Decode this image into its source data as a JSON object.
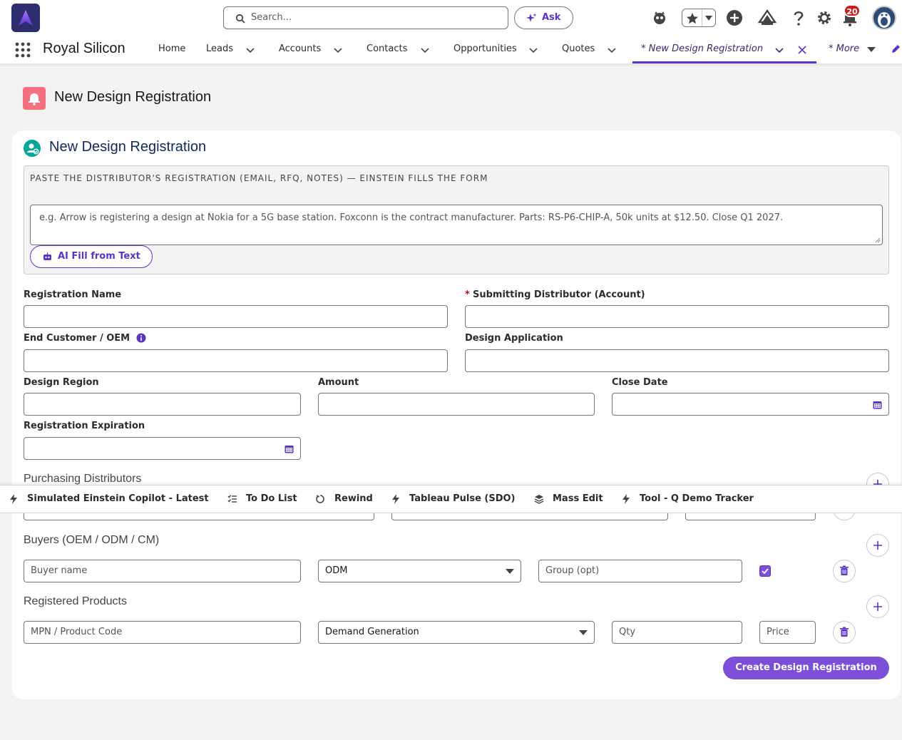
{
  "header": {
    "search_placeholder": "Search...",
    "ask_label": "Ask",
    "notification_count": "20"
  },
  "nav": {
    "app_name": "Royal Silicon",
    "items": [
      {
        "label": "Home"
      },
      {
        "label": "Leads"
      },
      {
        "label": "Accounts"
      },
      {
        "label": "Contacts"
      },
      {
        "label": "Opportunities"
      },
      {
        "label": "Quotes"
      }
    ],
    "active_tab": "* New Design Registration",
    "more": "* More"
  },
  "page": {
    "title": "New Design Registration"
  },
  "form": {
    "title": "New Design Registration",
    "ai_hint": "PASTE THE DISTRIBUTOR'S REGISTRATION (EMAIL, RFQ, NOTES) — EINSTEIN FILLS THE FORM",
    "ai_placeholder": "e.g. Arrow is registering a design at Nokia for a 5G base station. Foxconn is the contract manufacturer. Parts: RS-P6-CHIP-A, 50k units at $12.50. Close Q1 2027.",
    "ai_button": "AI Fill from Text",
    "fields": {
      "registration_name": "Registration Name",
      "required_mark": "*",
      "submitting_distributor": "Submitting Distributor (Account)",
      "end_customer": "End Customer / OEM",
      "design_application": "Design Application",
      "design_region": "Design Region",
      "amount": "Amount",
      "close_date": "Close Date",
      "registration_expiration": "Registration Expiration"
    },
    "purchasing_distributors": "Purchasing Distributors",
    "buyers": {
      "title": "Buyers (OEM / ODM / CM)",
      "buyer_placeholder": "Buyer name",
      "type_value": "ODM",
      "group_placeholder": "Group (opt)",
      "checked": true
    },
    "products": {
      "title": "Registered Products",
      "mpn_placeholder": "MPN / Product Code",
      "stage_value": "Demand Generation",
      "qty_placeholder": "Qty",
      "price_placeholder": "Price"
    },
    "submit_label": "Create Design Registration"
  },
  "utility_bar": {
    "items": [
      {
        "label": "Simulated Einstein Copilot - Latest",
        "icon": "bolt-icon"
      },
      {
        "label": "To Do List",
        "icon": "checklist-icon"
      },
      {
        "label": "Rewind",
        "icon": "rewind-icon"
      },
      {
        "label": "Tableau Pulse (SDO)",
        "icon": "bolt-icon"
      },
      {
        "label": "Mass Edit",
        "icon": "stack-icon"
      },
      {
        "label": "Tool - Q Demo Tracker",
        "icon": "bolt-icon"
      }
    ]
  },
  "colors": {
    "brand": "#5a33c9",
    "primary_button": "#7b4fd8",
    "page_icon": "#f4707e",
    "card_icon": "#06a59a",
    "badge": "#c91e1e"
  }
}
